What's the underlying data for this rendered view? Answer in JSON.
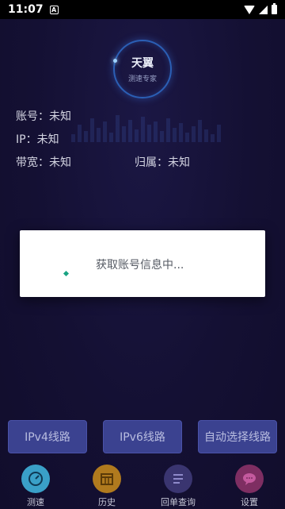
{
  "status_bar": {
    "time": "11:07",
    "app_badge": "A"
  },
  "logo": {
    "brand": "天翼",
    "subtitle": "测速专家"
  },
  "info": {
    "account_label": "账号：",
    "account_value": "未知",
    "ip_label": "IP：",
    "ip_value": "未知",
    "bandwidth_label": "带宽：",
    "bandwidth_value": "未知",
    "region_label": "归属：",
    "region_value": "未知"
  },
  "dialog": {
    "message": "获取账号信息中..."
  },
  "buttons": {
    "ipv4": "IPv4线路",
    "ipv6": "IPv6线路",
    "auto": "自动选择线路"
  },
  "nav": [
    {
      "label": "测速",
      "icon": "speedometer-icon",
      "color": "#3aa0c8"
    },
    {
      "label": "历史",
      "icon": "calendar-icon",
      "color": "#b07a1e"
    },
    {
      "label": "回单查询",
      "icon": "list-icon",
      "color": "#3a3570"
    },
    {
      "label": "设置",
      "icon": "chat-icon",
      "color": "#7e2e62"
    }
  ]
}
